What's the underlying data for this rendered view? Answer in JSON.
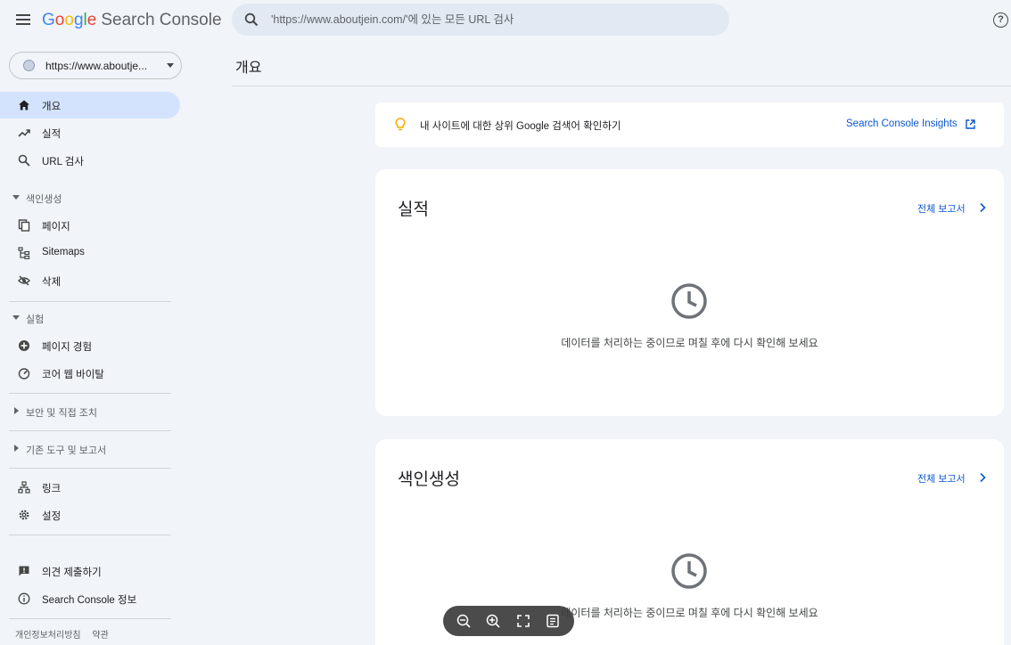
{
  "header": {
    "logo_google": "Google",
    "logo_product": "Search Console",
    "search_placeholder": "'https://www.aboutjein.com/'에 있는 모든 URL 검사"
  },
  "sidebar": {
    "property": "https://www.aboutje...",
    "items": [
      {
        "label": "개요",
        "icon": "home-icon"
      },
      {
        "label": "실적",
        "icon": "trending-up-icon"
      },
      {
        "label": "URL 검사",
        "icon": "search-icon"
      }
    ],
    "sections": {
      "indexing": {
        "label": "색인생성",
        "items": [
          {
            "label": "페이지",
            "icon": "pages-icon"
          },
          {
            "label": "Sitemaps",
            "icon": "sitemap-icon"
          },
          {
            "label": "삭제",
            "icon": "visibility-off-icon"
          }
        ]
      },
      "experience": {
        "label": "실험",
        "items": [
          {
            "label": "페이지 경험",
            "icon": "add-circle-icon"
          },
          {
            "label": "코어 웹 바이탈",
            "icon": "speed-icon"
          }
        ]
      },
      "security": {
        "label": "보안 및 직접 조치"
      },
      "legacy": {
        "label": "기존 도구 및 보고서"
      }
    },
    "bottom_items": [
      {
        "label": "링크",
        "icon": "links-icon"
      },
      {
        "label": "설정",
        "icon": "settings-icon"
      }
    ],
    "help_items": [
      {
        "label": "의견 제출하기",
        "icon": "feedback-icon"
      },
      {
        "label": "Search Console 정보",
        "icon": "info-icon"
      }
    ],
    "footer": {
      "privacy": "개인정보처리방침",
      "terms": "약관"
    }
  },
  "main": {
    "page_title": "개요",
    "insight": {
      "text": "내 사이트에 대한 상위 Google 검색어 확인하기",
      "link": "Search Console Insights"
    },
    "cards": [
      {
        "title": "실적",
        "link": "전체 보고서",
        "message": "데이터를 처리하는 중이므로 며칠 후에 다시 확인해 보세요"
      },
      {
        "title": "색인생성",
        "link": "전체 보고서",
        "message": "데이터를 처리하는 중이므로 며칠 후에 다시 확인해 보세요"
      }
    ]
  },
  "colors": {
    "background": "#f1f4f9",
    "active_nav": "#d3e3fd",
    "link": "#0b57d0",
    "bulb": "#f9ab00"
  }
}
